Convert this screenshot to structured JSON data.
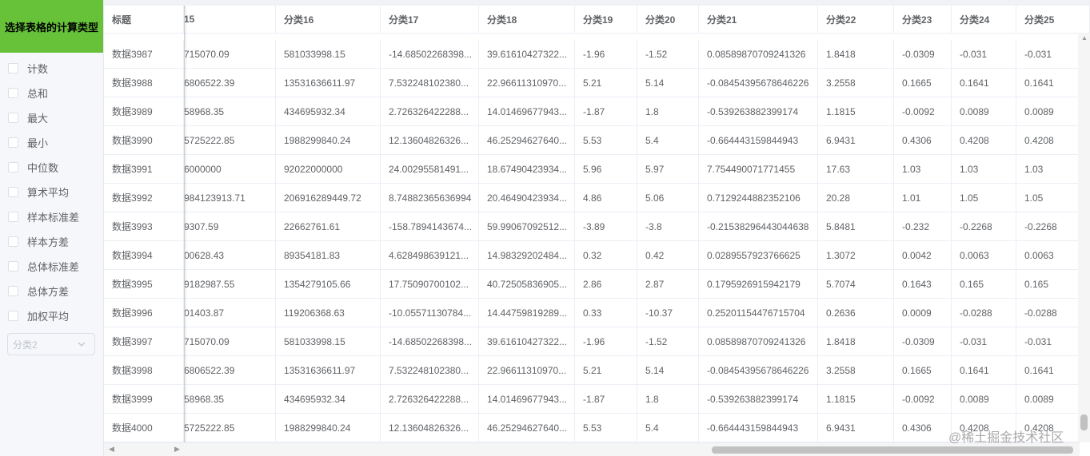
{
  "left_panel": {
    "title": "选择表格的计算类型",
    "options": [
      {
        "label": "计数"
      },
      {
        "label": "总和"
      },
      {
        "label": "最大"
      },
      {
        "label": "最小"
      },
      {
        "label": "中位数"
      },
      {
        "label": "算术平均"
      },
      {
        "label": "样本标准差"
      },
      {
        "label": "样本方差"
      },
      {
        "label": "总体标准差"
      },
      {
        "label": "总体方差"
      },
      {
        "label": "加权平均"
      }
    ],
    "select": {
      "placeholder": "分类2"
    }
  },
  "table": {
    "headers": [
      "标题",
      "15",
      "分类16",
      "分类17",
      "分类18",
      "分类19",
      "分类20",
      "分类21",
      "分类22",
      "分类23",
      "分类24",
      "分类25"
    ],
    "rows": [
      [
        "数据3987",
        "715070.09",
        "581033998.15",
        "-14.68502268398...",
        "39.61610427322...",
        "-1.96",
        "-1.52",
        "0.08589870709241326",
        "1.8418",
        "-0.0309",
        "-0.031",
        "-0.031"
      ],
      [
        "数据3988",
        "6806522.39",
        "13531636611.97",
        "7.532248102380...",
        "22.96611310970...",
        "5.21",
        "5.14",
        "-0.08454395678646226",
        "3.2558",
        "0.1665",
        "0.1641",
        "0.1641"
      ],
      [
        "数据3989",
        "58968.35",
        "434695932.34",
        "2.726326422288...",
        "14.01469677943...",
        "-1.87",
        "1.8",
        "-0.539263882399174",
        "1.1815",
        "-0.0092",
        "0.0089",
        "0.0089"
      ],
      [
        "数据3990",
        "5725222.85",
        "1988299840.24",
        "12.13604826326...",
        "46.25294627640...",
        "5.53",
        "5.4",
        "-0.664443159844943",
        "6.9431",
        "0.4306",
        "0.4208",
        "0.4208"
      ],
      [
        "数据3991",
        "6000000",
        "92022000000",
        "24.00295581491...",
        "18.67490423934...",
        "5.96",
        "5.97",
        "7.754490071771455",
        "17.63",
        "1.03",
        "1.03",
        "1.03"
      ],
      [
        "数据3992",
        "984123913.71",
        "206916289449.72",
        "8.74882365636994",
        "20.46490423934...",
        "4.86",
        "5.06",
        "0.7129244882352106",
        "20.28",
        "1.01",
        "1.05",
        "1.05"
      ],
      [
        "数据3993",
        "9307.59",
        "22662761.61",
        "-158.7894143674...",
        "59.99067092512...",
        "-3.89",
        "-3.8",
        "-0.21538296443044638",
        "5.8481",
        "-0.232",
        "-0.2268",
        "-0.2268"
      ],
      [
        "数据3994",
        "00628.43",
        "89354181.83",
        "4.628498639121...",
        "14.98329202484...",
        "0.32",
        "0.42",
        "0.0289557923766625",
        "1.3072",
        "0.0042",
        "0.0063",
        "0.0063"
      ],
      [
        "数据3995",
        "9182987.55",
        "1354279105.66",
        "17.75090700102...",
        "40.72505836905...",
        "2.86",
        "2.87",
        "0.1795926915942179",
        "5.7074",
        "0.1643",
        "0.165",
        "0.165"
      ],
      [
        "数据3996",
        "01403.87",
        "119206368.63",
        "-10.05571130784...",
        "14.44759819289...",
        "0.33",
        "-10.37",
        "0.25201154476715704",
        "0.2636",
        "0.0009",
        "-0.0288",
        "-0.0288"
      ],
      [
        "数据3997",
        "715070.09",
        "581033998.15",
        "-14.68502268398...",
        "39.61610427322...",
        "-1.96",
        "-1.52",
        "0.08589870709241326",
        "1.8418",
        "-0.0309",
        "-0.031",
        "-0.031"
      ],
      [
        "数据3998",
        "6806522.39",
        "13531636611.97",
        "7.532248102380...",
        "22.96611310970...",
        "5.21",
        "5.14",
        "-0.08454395678646226",
        "3.2558",
        "0.1665",
        "0.1641",
        "0.1641"
      ],
      [
        "数据3999",
        "58968.35",
        "434695932.34",
        "2.726326422288...",
        "14.01469677943...",
        "-1.87",
        "1.8",
        "-0.539263882399174",
        "1.1815",
        "-0.0092",
        "0.0089",
        "0.0089"
      ],
      [
        "数据4000",
        "5725222.85",
        "1988299840.24",
        "12.13604826326...",
        "46.25294627640...",
        "5.53",
        "5.4",
        "-0.664443159844943",
        "6.9431",
        "0.4306",
        "0.4208",
        "0.4208"
      ]
    ]
  },
  "watermark": "@稀土掘金技术社区",
  "icons": {
    "select_arrow": "chevron-down-icon",
    "scroll_left": "arrow-left-icon",
    "scroll_right": "arrow-right-icon"
  },
  "colors": {
    "header_green": "#67c23a"
  }
}
